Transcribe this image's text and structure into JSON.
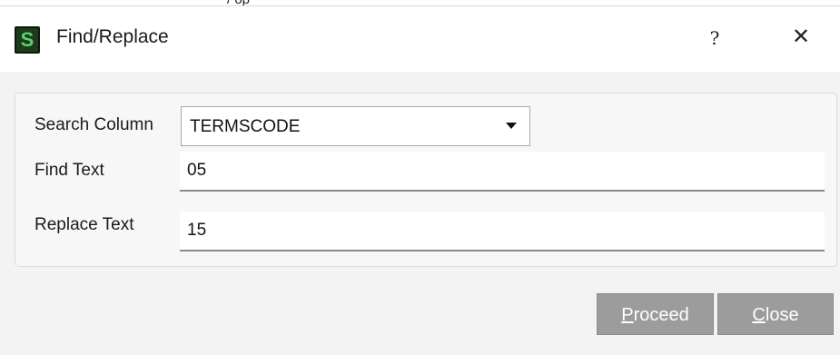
{
  "window": {
    "title": "Find/Replace",
    "logo_letter": "S",
    "help_label": "?",
    "close_label": "✕",
    "top_cropped_text": "/ op"
  },
  "form": {
    "search_column": {
      "label": "Search Column",
      "value": "TERMSCODE"
    },
    "find_text": {
      "label": "Find Text",
      "value": "05"
    },
    "replace_text": {
      "label": "Replace Text",
      "value": "15"
    }
  },
  "buttons": {
    "proceed": {
      "mnemonic": "P",
      "rest": "roceed"
    },
    "close": {
      "mnemonic": "C",
      "rest": "lose"
    }
  },
  "colors": {
    "logo_bg": "#1e3a1e",
    "logo_fg": "#58d26a",
    "button_bg": "#9c9c9c"
  }
}
